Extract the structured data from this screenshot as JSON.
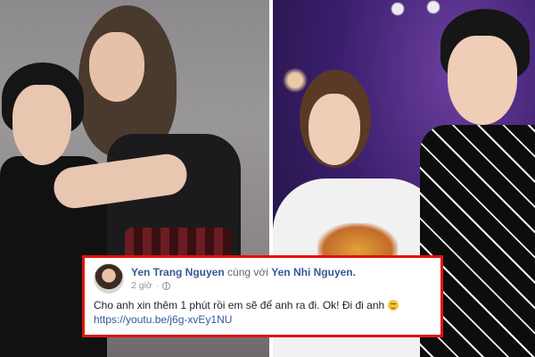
{
  "post": {
    "author": "Yen Trang Nguyen",
    "with_text": "cùng với",
    "tagged": "Yen Nhi Nguyen.",
    "time": "2 giờ",
    "separator": "·",
    "message": "Cho anh xin thêm 1 phút rồi em sẽ để anh ra đi. Ok! Đi đi anh",
    "link": "https://youtu.be/j6g-xvEy1NU",
    "border_color": "#e0120f",
    "link_color": "#365899"
  },
  "icons": {
    "privacy": "globe-icon",
    "emoji": "smiling-face-emoji-icon"
  }
}
